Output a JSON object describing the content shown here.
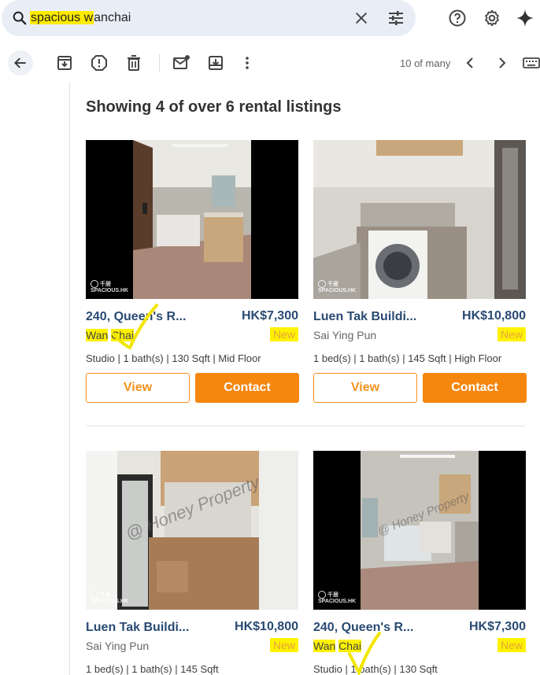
{
  "search": {
    "query_highlight": "spacious w",
    "query_rest": "anchai"
  },
  "toolbar": {
    "pager": "10 of many"
  },
  "heading": "Showing 4 of over 6 rental listings",
  "watermark_brand": "SPACIOUS.HK",
  "watermark_cn": "千居",
  "listings": [
    {
      "title": "240, Queen's R...",
      "price": "HK$7,300",
      "district_part1": "Wan",
      "district_part2": "Chai",
      "badge": "New",
      "specs": "Studio | 1 bath(s) | 130 Sqft | Mid Floor",
      "view": "View",
      "contact": "Contact"
    },
    {
      "title": "Luen Tak Buildi...",
      "price": "HK$10,800",
      "district": "Sai Ying Pun",
      "badge": "New",
      "specs": "1 bed(s) | 1 bath(s) | 145 Sqft | High Floor",
      "view": "View",
      "contact": "Contact"
    },
    {
      "title": "Luen Tak Buildi...",
      "price": "HK$10,800",
      "district": "Sai Ying Pun",
      "badge": "New",
      "specs": "1 bed(s) | 1 bath(s) | 145 Sqft",
      "photo_watermark": "@ Honey Property"
    },
    {
      "title": "240, Queen's R...",
      "price": "HK$7,300",
      "district_part1": "Wan",
      "district_part2": "Chai",
      "badge": "New",
      "specs": "Studio | 1 bath(s) | 130 Sqft",
      "photo_watermark": "@ Honey Property"
    }
  ],
  "colors": {
    "accent": "#f5860e",
    "title": "#2a4a73",
    "highlight": "#fff200"
  }
}
